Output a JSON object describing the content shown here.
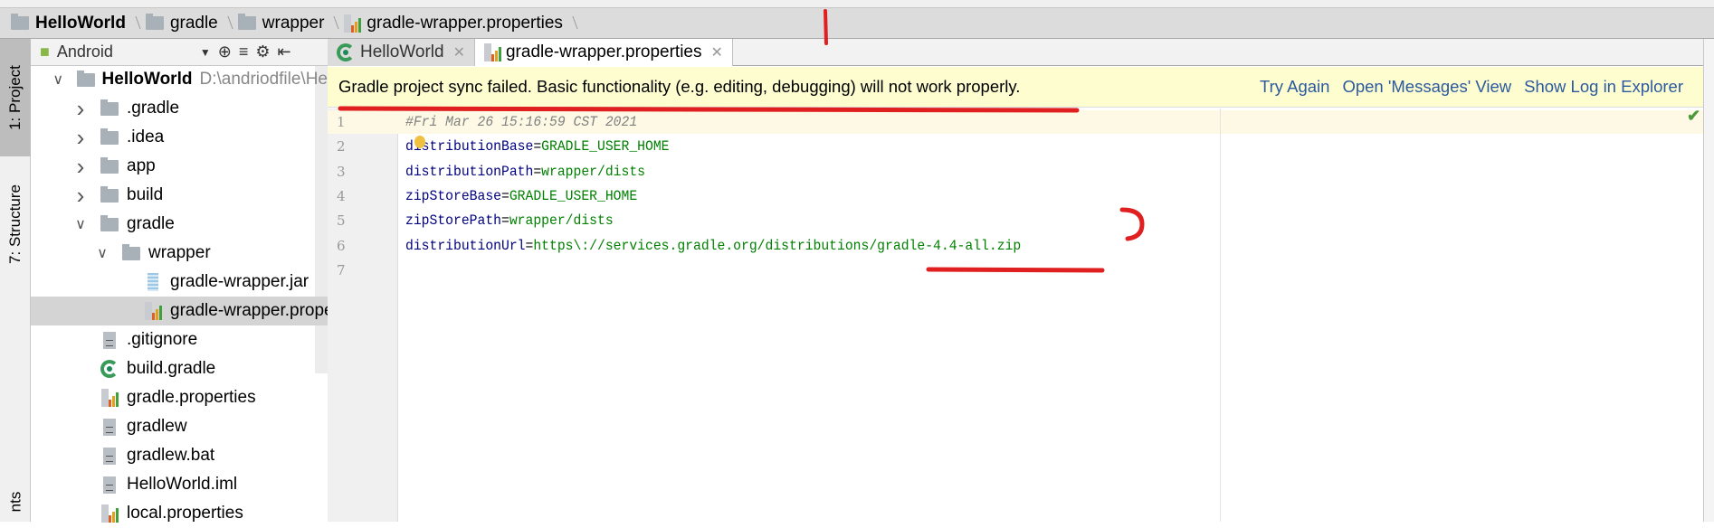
{
  "breadcrumb": [
    "HelloWorld",
    "gradle",
    "wrapper",
    "gradle-wrapper.properties"
  ],
  "project_tool": {
    "view_selector": "Android",
    "side_tabs": [
      "1: Project",
      "7: Structure",
      "nts"
    ]
  },
  "tree": [
    {
      "label": "HelloWorld",
      "path": "D:\\andriodfile\\He",
      "level": 0,
      "expanded": true,
      "icon": "module-folder-icon"
    },
    {
      "label": ".gradle",
      "level": 1,
      "expanded": false,
      "icon": "folder-icon"
    },
    {
      "label": ".idea",
      "level": 1,
      "expanded": false,
      "icon": "folder-icon"
    },
    {
      "label": "app",
      "level": 1,
      "expanded": false,
      "icon": "folder-icon"
    },
    {
      "label": "build",
      "level": 1,
      "expanded": false,
      "icon": "folder-icon"
    },
    {
      "label": "gradle",
      "level": 1,
      "expanded": true,
      "icon": "folder-icon"
    },
    {
      "label": "wrapper",
      "level": 2,
      "expanded": true,
      "icon": "folder-icon"
    },
    {
      "label": "gradle-wrapper.jar",
      "level": 3,
      "icon": "jar-icon"
    },
    {
      "label": "gradle-wrapper.properties",
      "level": 3,
      "icon": "properties-icon",
      "selected": true
    },
    {
      "label": ".gitignore",
      "level": 1,
      "icon": "text-file-icon"
    },
    {
      "label": "build.gradle",
      "level": 1,
      "icon": "gradle-icon"
    },
    {
      "label": "gradle.properties",
      "level": 1,
      "icon": "properties-icon"
    },
    {
      "label": "gradlew",
      "level": 1,
      "icon": "text-file-icon"
    },
    {
      "label": "gradlew.bat",
      "level": 1,
      "icon": "text-file-icon"
    },
    {
      "label": "HelloWorld.iml",
      "level": 1,
      "icon": "module-file-icon"
    },
    {
      "label": "local.properties",
      "level": 1,
      "icon": "properties-icon"
    }
  ],
  "tabs": [
    {
      "label": "HelloWorld",
      "active": false
    },
    {
      "label": "gradle-wrapper.properties",
      "active": true
    }
  ],
  "banner": {
    "message": "Gradle project sync failed. Basic functionality (e.g. editing, debugging) will not work properly.",
    "links": [
      "Try Again",
      "Open 'Messages' View",
      "Show Log in Explorer"
    ]
  },
  "editor": {
    "lines": [
      {
        "n": "1",
        "comment": "#Fri Mar 26 15:16:59 CST 2021"
      },
      {
        "n": "2",
        "key": "distributionBase",
        "value": "GRADLE_USER_HOME"
      },
      {
        "n": "3",
        "key": "distributionPath",
        "value": "wrapper/dists"
      },
      {
        "n": "4",
        "key": "zipStoreBase",
        "value": "GRADLE_USER_HOME"
      },
      {
        "n": "5",
        "key": "zipStorePath",
        "value": "wrapper/dists"
      },
      {
        "n": "6",
        "key": "distributionUrl",
        "value": "https\\://services.gradle.org/distributions/gradle-4.4-all.zip"
      },
      {
        "n": "7"
      }
    ]
  },
  "colors": {
    "banner_bg": "#fdfdcf",
    "link": "#2c5aa0",
    "annotation": "#e02020",
    "key": "#000080",
    "value": "#008000"
  }
}
